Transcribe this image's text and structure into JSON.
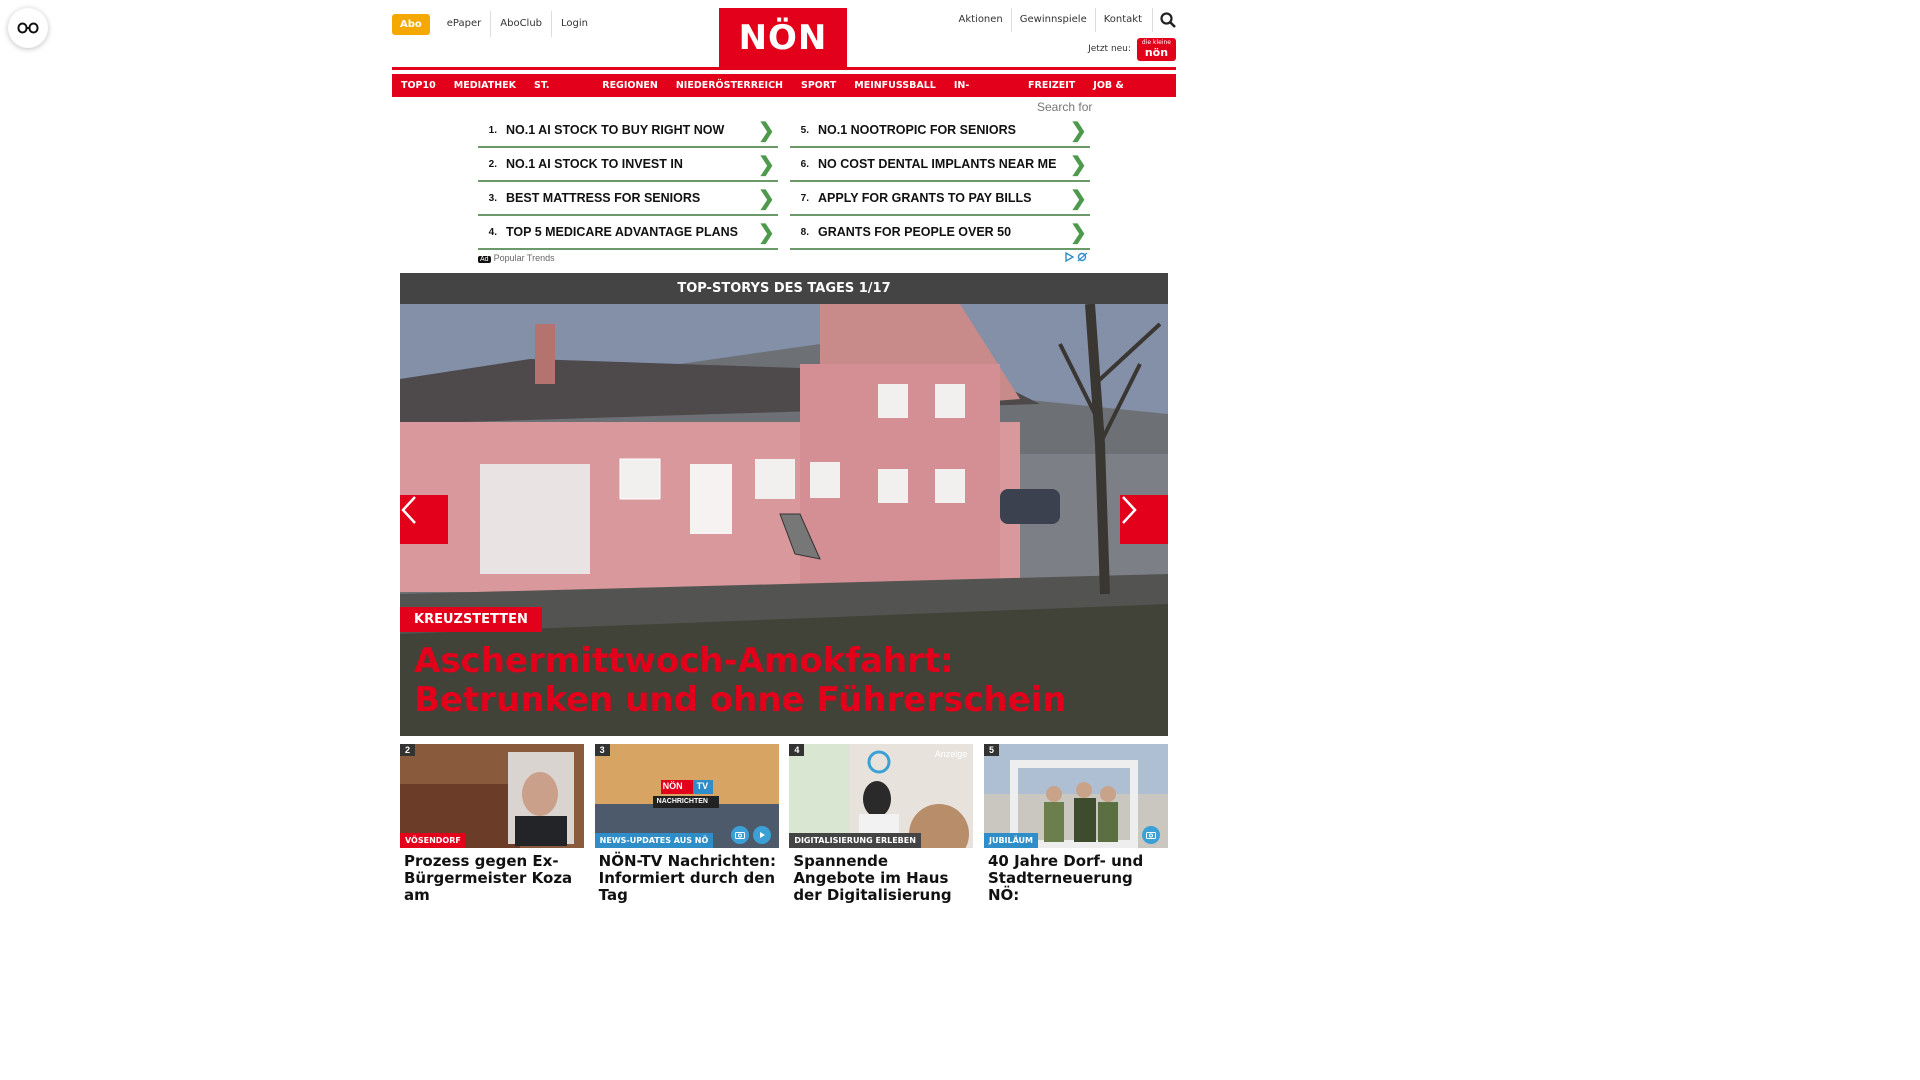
{
  "header": {
    "abo": "Abo",
    "left_links": [
      "ePaper",
      "AboClub",
      "Login"
    ],
    "logo": "NÖN",
    "right_links": [
      "Aktionen",
      "Gewinnspiele",
      "Kontakt"
    ],
    "jetzt_neu": "Jetzt neu:",
    "jetzt_badge_small": "die kleine",
    "jetzt_badge": "nön"
  },
  "nav": [
    "TOP10",
    "MEDIATHEK",
    "ST. PÖLTEN",
    "REGIONEN",
    "NIEDERÖSTERREICH",
    "SPORT",
    "MEINFUSSBALL",
    "IN-AUSLAND",
    "FREIZEIT",
    "JOB & KARRIERE"
  ],
  "search_for": "Search for",
  "ad": {
    "left": [
      {
        "num": "1.",
        "text": "NO.1 AI STOCK TO BUY RIGHT NOW"
      },
      {
        "num": "2.",
        "text": "NO.1 AI STOCK TO INVEST IN"
      },
      {
        "num": "3.",
        "text": "BEST MATTRESS FOR SENIORS"
      },
      {
        "num": "4.",
        "text": "TOP 5 MEDICARE ADVANTAGE PLANS"
      }
    ],
    "right": [
      {
        "num": "5.",
        "text": "NO.1 NOOTROPIC FOR SENIORS"
      },
      {
        "num": "6.",
        "text": "NO COST DENTAL IMPLANTS NEAR ME"
      },
      {
        "num": "7.",
        "text": "APPLY FOR GRANTS TO PAY BILLS"
      },
      {
        "num": "8.",
        "text": "GRANTS FOR PEOPLE OVER 50"
      }
    ],
    "ad_label": "Ad",
    "source": "Popular Trends",
    "accent": "#4d9a4d"
  },
  "topstory": {
    "bar": "TOP-STORYS DES TAGES 1/17",
    "category": "KREUZSTETTEN",
    "title": "Aschermittwoch-Amokfahrt: Betrunken und ohne Führerschein"
  },
  "cards": [
    {
      "num": "2",
      "category": "VÖSENDORF",
      "title": "Prozess gegen Ex-Bürgermeister Koza am"
    },
    {
      "num": "3",
      "category": "NEWS-UPDATES AUS NÖ",
      "title": "NÖN-TV Nachrichten: Informiert durch den Tag",
      "img_text_1": "NÖN",
      "img_text_2": "TV",
      "img_text_3": "NACHRICHTEN"
    },
    {
      "num": "4",
      "category": "DIGITALISIERUNG ERLEBEN",
      "title": "Spannende Angebote im Haus der Digitalisierung",
      "img_badge": "Anzeige"
    },
    {
      "num": "5",
      "category": "JUBILÄUM",
      "title": "40 Jahre Dorf- und Stadterneuerung NÖ:"
    }
  ],
  "colors": {
    "brand_red": "#e2001a",
    "abo_orange": "#f5a800",
    "topstory_bar": "#444444",
    "category_blue": "#2f8ec8"
  }
}
